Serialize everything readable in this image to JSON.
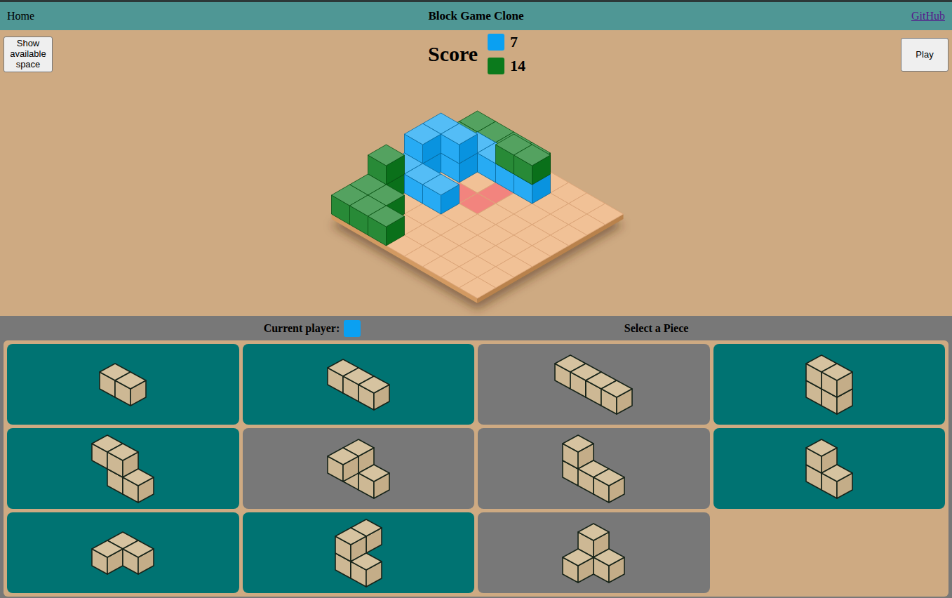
{
  "nav": {
    "home": "Home",
    "title": "Block Game Clone",
    "github": "GitHub"
  },
  "buttons": {
    "show_space": "Show available space",
    "play": "Play"
  },
  "score": {
    "label": "Score",
    "players": [
      {
        "value": "7",
        "color": "#0aa0f2"
      },
      {
        "value": "14",
        "color": "#0b7a1c"
      }
    ]
  },
  "board": {
    "size": 8,
    "highlight": [
      [
        2,
        3
      ],
      [
        3,
        3
      ],
      [
        3,
        2
      ]
    ],
    "cubes": [
      {
        "pos": [
          0,
          0,
          0
        ],
        "player": 1
      },
      {
        "pos": [
          0,
          1,
          0
        ],
        "player": 1
      },
      {
        "pos": [
          0,
          2,
          0
        ],
        "player": 1
      },
      {
        "pos": [
          0,
          3,
          0
        ],
        "player": 1
      },
      {
        "pos": [
          1,
          0,
          0
        ],
        "player": 1
      },
      {
        "pos": [
          1,
          3,
          1
        ],
        "player": 1
      },
      {
        "pos": [
          1,
          4,
          1
        ],
        "player": 1
      },
      {
        "pos": [
          5,
          0,
          0
        ],
        "player": 1
      },
      {
        "pos": [
          5,
          0,
          1
        ],
        "player": 1
      },
      {
        "pos": [
          6,
          0,
          0
        ],
        "player": 1
      },
      {
        "pos": [
          6,
          1,
          0
        ],
        "player": 1
      },
      {
        "pos": [
          7,
          0,
          0
        ],
        "player": 1
      },
      {
        "pos": [
          7,
          1,
          0
        ],
        "player": 1
      },
      {
        "pos": [
          7,
          2,
          0
        ],
        "player": 1
      },
      {
        "pos": [
          1,
          1,
          0
        ],
        "player": 0
      },
      {
        "pos": [
          1,
          2,
          0
        ],
        "player": 0
      },
      {
        "pos": [
          1,
          3,
          0
        ],
        "player": 0
      },
      {
        "pos": [
          1,
          4,
          0
        ],
        "player": 0
      },
      {
        "pos": [
          2,
          0,
          0
        ],
        "player": 0
      },
      {
        "pos": [
          2,
          0,
          1
        ],
        "player": 0
      },
      {
        "pos": [
          2,
          1,
          0
        ],
        "player": 0
      },
      {
        "pos": [
          2,
          1,
          1
        ],
        "player": 0
      },
      {
        "pos": [
          3,
          0,
          0
        ],
        "player": 0
      },
      {
        "pos": [
          3,
          0,
          1
        ],
        "player": 0
      },
      {
        "pos": [
          4,
          0,
          0
        ],
        "player": 0
      },
      {
        "pos": [
          4,
          1,
          0
        ],
        "player": 0
      },
      {
        "pos": [
          4,
          2,
          0
        ],
        "player": 0
      }
    ]
  },
  "current_player": {
    "label": "Current player:",
    "color": "#0aa0f2"
  },
  "prompt": "Select a Piece",
  "pieces": [
    {
      "cubes": [
        [
          0,
          0,
          0
        ],
        [
          0,
          1,
          0
        ]
      ],
      "disabled": false
    },
    {
      "cubes": [
        [
          0,
          0,
          0
        ],
        [
          0,
          1,
          0
        ],
        [
          0,
          2,
          0
        ]
      ],
      "disabled": false
    },
    {
      "cubes": [
        [
          0,
          0,
          0
        ],
        [
          0,
          1,
          0
        ],
        [
          0,
          2,
          0
        ],
        [
          0,
          3,
          0
        ]
      ],
      "disabled": true
    },
    {
      "cubes": [
        [
          0,
          0,
          0
        ],
        [
          0,
          1,
          0
        ],
        [
          0,
          0,
          1
        ],
        [
          0,
          1,
          1
        ]
      ],
      "disabled": false
    },
    {
      "cubes": [
        [
          0,
          0,
          1
        ],
        [
          0,
          1,
          1
        ],
        [
          0,
          1,
          0
        ],
        [
          0,
          2,
          0
        ]
      ],
      "disabled": false
    },
    {
      "cubes": [
        [
          0,
          0,
          1
        ],
        [
          0,
          0,
          0
        ],
        [
          0,
          1,
          0
        ],
        [
          1,
          0,
          1
        ]
      ],
      "disabled": true
    },
    {
      "cubes": [
        [
          0,
          0,
          1
        ],
        [
          0,
          0,
          0
        ],
        [
          0,
          1,
          0
        ],
        [
          0,
          2,
          0
        ]
      ],
      "disabled": true
    },
    {
      "cubes": [
        [
          0,
          0,
          1
        ],
        [
          0,
          0,
          0
        ],
        [
          0,
          1,
          0
        ]
      ],
      "disabled": false
    },
    {
      "cubes": [
        [
          1,
          0,
          0
        ],
        [
          0,
          0,
          0
        ],
        [
          0,
          1,
          0
        ]
      ],
      "disabled": false
    },
    {
      "cubes": [
        [
          0,
          0,
          1
        ],
        [
          1,
          0,
          1
        ],
        [
          1,
          0,
          0
        ],
        [
          1,
          1,
          0
        ]
      ],
      "disabled": false
    },
    {
      "cubes": [
        [
          0,
          0,
          1
        ],
        [
          0,
          0,
          0
        ],
        [
          1,
          0,
          0
        ],
        [
          0,
          1,
          0
        ]
      ],
      "disabled": true
    }
  ]
}
